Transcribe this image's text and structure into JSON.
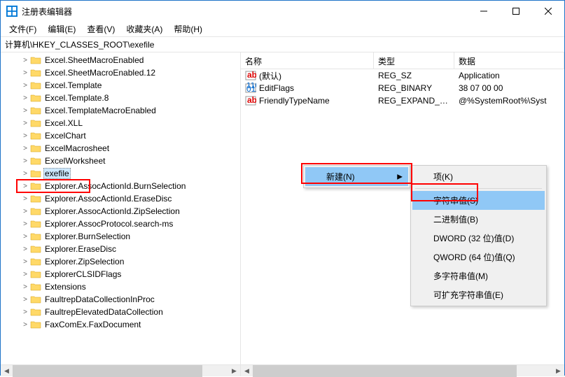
{
  "window": {
    "title": "注册表编辑器"
  },
  "menu": {
    "file": "文件(F)",
    "edit": "编辑(E)",
    "view": "查看(V)",
    "favorites": "收藏夹(A)",
    "help": "帮助(H)"
  },
  "address": "计算机\\HKEY_CLASSES_ROOT\\exefile",
  "tree": {
    "items": [
      "Excel.SheetMacroEnabled",
      "Excel.SheetMacroEnabled.12",
      "Excel.Template",
      "Excel.Template.8",
      "Excel.TemplateMacroEnabled",
      "Excel.XLL",
      "ExcelChart",
      "ExcelMacrosheet",
      "ExcelWorksheet",
      "exefile",
      "Explorer.AssocActionId.BurnSelection",
      "Explorer.AssocActionId.EraseDisc",
      "Explorer.AssocActionId.ZipSelection",
      "Explorer.AssocProtocol.search-ms",
      "Explorer.BurnSelection",
      "Explorer.EraseDisc",
      "Explorer.ZipSelection",
      "ExplorerCLSIDFlags",
      "Extensions",
      "FaultrepDataCollectionInProc",
      "FaultrepElevatedDataCollection",
      "FaxComEx.FaxDocument"
    ],
    "selected_index": 9
  },
  "list": {
    "headers": {
      "name": "名称",
      "type": "类型",
      "data": "数据"
    },
    "rows": [
      {
        "icon": "str",
        "name": "(默认)",
        "type": "REG_SZ",
        "data": "Application"
      },
      {
        "icon": "bin",
        "name": "EditFlags",
        "type": "REG_BINARY",
        "data": "38 07 00 00"
      },
      {
        "icon": "str",
        "name": "FriendlyTypeName",
        "type": "REG_EXPAND_SZ",
        "data": "@%SystemRoot%\\Syst"
      }
    ]
  },
  "context_menu": {
    "parent": {
      "label": "新建(N)"
    },
    "items": [
      {
        "label": "项(K)"
      },
      {
        "label": "字符串值(S)",
        "highlight": true
      },
      {
        "label": "二进制值(B)"
      },
      {
        "label": "DWORD (32 位)值(D)"
      },
      {
        "label": "QWORD (64 位)值(Q)"
      },
      {
        "label": "多字符串值(M)"
      },
      {
        "label": "可扩充字符串值(E)"
      }
    ]
  }
}
